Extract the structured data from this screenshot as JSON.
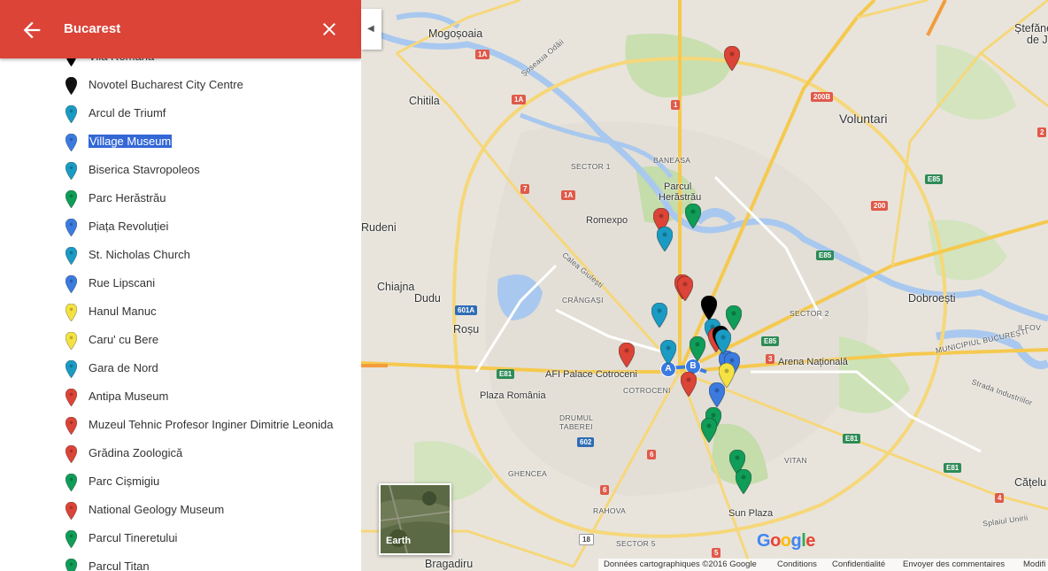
{
  "header": {
    "title": "Bucarest",
    "back_icon": "arrow-back-icon",
    "close_icon": "close-icon",
    "color": "#db4437"
  },
  "places": [
    {
      "name": "Vila Romana",
      "color": "#000000"
    },
    {
      "name": "Novotel Bucharest City Centre",
      "color": "#111111"
    },
    {
      "name": "Arcul de Triumf",
      "color": "#1a9bc4"
    },
    {
      "name": "Village Museum",
      "color": "#3b7be0",
      "selected": true
    },
    {
      "name": "Biserica Stavropoleos",
      "color": "#1a9bc4"
    },
    {
      "name": "Parc Herăstrău",
      "color": "#0f9d58"
    },
    {
      "name": "Piața Revoluției",
      "color": "#3b7be0"
    },
    {
      "name": "St. Nicholas Church",
      "color": "#1a9bc4"
    },
    {
      "name": "Rue Lipscani",
      "color": "#3b7be0"
    },
    {
      "name": "Hanul Manuc",
      "color": "#f4e242"
    },
    {
      "name": "Caru' cu Bere",
      "color": "#f4e242"
    },
    {
      "name": "Gara de Nord",
      "color": "#1a9bc4"
    },
    {
      "name": "Antipa Museum",
      "color": "#db4437"
    },
    {
      "name": "Muzeul Tehnic Profesor Inginer Dimitrie Leonida",
      "color": "#db4437"
    },
    {
      "name": "Grădina Zoologică",
      "color": "#db4437"
    },
    {
      "name": "Parc Cișmigiu",
      "color": "#0f9d58"
    },
    {
      "name": "National Geology Museum",
      "color": "#db4437"
    },
    {
      "name": "Parcul Tineretului",
      "color": "#0f9d58"
    },
    {
      "name": "Parcul Titan",
      "color": "#0f9d58"
    }
  ],
  "map": {
    "labels": {
      "mogosoaia": "Mogoșoaia",
      "chitila": "Chitila",
      "stefanesti": "Ștefăneștii",
      "dejos": "de Jos",
      "voluntari": "Voluntari",
      "rudeni": "Rudeni",
      "romexpo": "Romexpo",
      "parcul": "Parcul",
      "herastrau": "Herăstrău",
      "chiajna": "Chiajna",
      "dudu": "Dudu",
      "rosu": "Roșu",
      "dobroesti": "Dobroești",
      "arena": "Arena Națională",
      "afi": "AFI Palace Cotroceni",
      "plaza": "Plaza România",
      "sunplaza": "Sun Plaza",
      "bragadiru": "Bragadiru",
      "catelu": "Cățelu",
      "cotroceni": "COTROCENI",
      "drumul": "DRUMUL",
      "taberei": "TABEREI",
      "ghencea": "GHENCEA",
      "rahova": "RAHOVA",
      "vitan": "VITAN",
      "sector1": "SECTOR 1",
      "sector2": "SECTOR 2",
      "sector5": "SECTOR 5",
      "baneasa": "BANEASA",
      "crangasi": "CRÂNGAȘI",
      "municipiul": "MUNICIPIUL BUCUREȘTI",
      "ilfov": "ILFOV",
      "splaiul": "Splaiul Unirii",
      "strada_industr": "Strada Industriilor",
      "calea_giulesti": "Calea Giulești",
      "soseaua": "Șoseaua Odăii"
    },
    "shields": {
      "s1a_top": "1A",
      "s1a_mid": "1A",
      "s1a_low": "1A",
      "s1": "1",
      "s7": "7",
      "s200b": "200B",
      "s200": "200",
      "e85a": "E85",
      "e85b": "E85",
      "e85c": "E85",
      "e81a": "E81",
      "e81b": "E81",
      "e81c": "E81",
      "s601a": "601A",
      "s602": "602",
      "s6a": "6",
      "s6b": "6",
      "s5": "5",
      "s4": "4",
      "s3": "3",
      "s18": "18",
      "s2": "2"
    },
    "earth_label": "Earth",
    "markers": [
      {
        "color": "#db4437"
      },
      {
        "color": "#db4437"
      },
      {
        "color": "#0f9d58"
      },
      {
        "color": "#1a9bc4"
      },
      {
        "color": "#db4437"
      },
      {
        "color": "#db4437"
      },
      {
        "color": "#000000"
      },
      {
        "color": "#1a9bc4"
      },
      {
        "color": "#0f9d58"
      },
      {
        "color": "#1a9bc4"
      },
      {
        "color": "#0f9d58"
      },
      {
        "color": "#db4437"
      },
      {
        "color": "#1a9bc4"
      },
      {
        "color": "#3b7be0"
      },
      {
        "color": "#3b7be0"
      },
      {
        "color": "#f4e242"
      },
      {
        "color": "#db4437"
      },
      {
        "color": "#3b7be0"
      },
      {
        "color": "#db4437"
      },
      {
        "color": "#0f9d58"
      },
      {
        "color": "#0f9d58"
      },
      {
        "color": "#0f9d58"
      },
      {
        "color": "#0f9d58"
      },
      {
        "color": "#000000"
      },
      {
        "color": "#1a9bc4"
      }
    ],
    "route_a": "A",
    "route_b": "B"
  },
  "footer": {
    "data": "Données cartographiques ©2016 Google",
    "conditions": "Conditions",
    "privacy": "Confidentialité",
    "feedback": "Envoyer des commentaires",
    "modif": "Modifi"
  },
  "google_logo": "Google"
}
